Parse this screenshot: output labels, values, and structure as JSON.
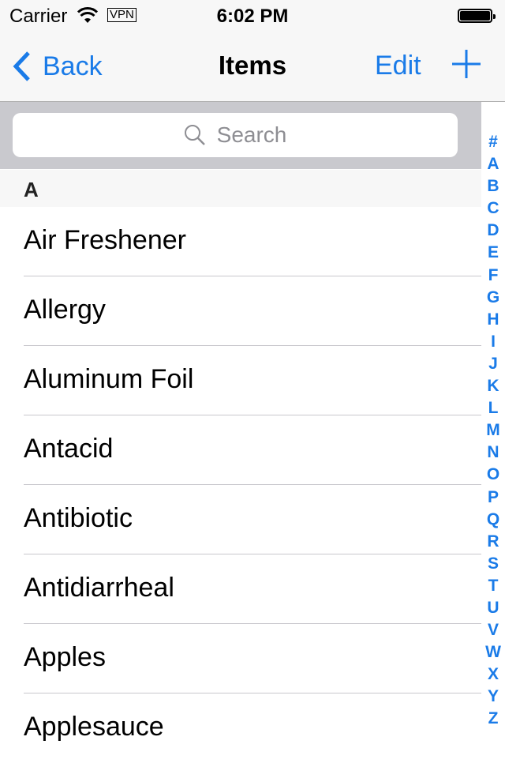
{
  "status_bar": {
    "carrier": "Carrier",
    "wifi_icon": "wifi-icon",
    "vpn": "VPN",
    "time": "6:02 PM",
    "battery_icon": "battery-full-icon"
  },
  "nav_bar": {
    "back_label": "Back",
    "back_icon": "chevron-left-icon",
    "title": "Items",
    "edit_label": "Edit",
    "add_icon": "plus-icon"
  },
  "search": {
    "placeholder": "Search",
    "value": "",
    "icon": "search-icon"
  },
  "section": {
    "header": "A"
  },
  "items": [
    {
      "label": "Air Freshener"
    },
    {
      "label": "Allergy"
    },
    {
      "label": "Aluminum Foil"
    },
    {
      "label": "Antacid"
    },
    {
      "label": "Antibiotic"
    },
    {
      "label": "Antidiarrheal"
    },
    {
      "label": "Apples"
    },
    {
      "label": "Applesauce"
    }
  ],
  "index": [
    "#",
    "A",
    "B",
    "C",
    "D",
    "E",
    "F",
    "G",
    "H",
    "I",
    "J",
    "K",
    "L",
    "M",
    "N",
    "O",
    "P",
    "Q",
    "R",
    "S",
    "T",
    "U",
    "V",
    "W",
    "X",
    "Y",
    "Z"
  ],
  "colors": {
    "accent": "#1a7be8",
    "search_bg": "#c9c9ce",
    "section_bg": "#f7f7f7",
    "separator": "#c8c7cc"
  }
}
